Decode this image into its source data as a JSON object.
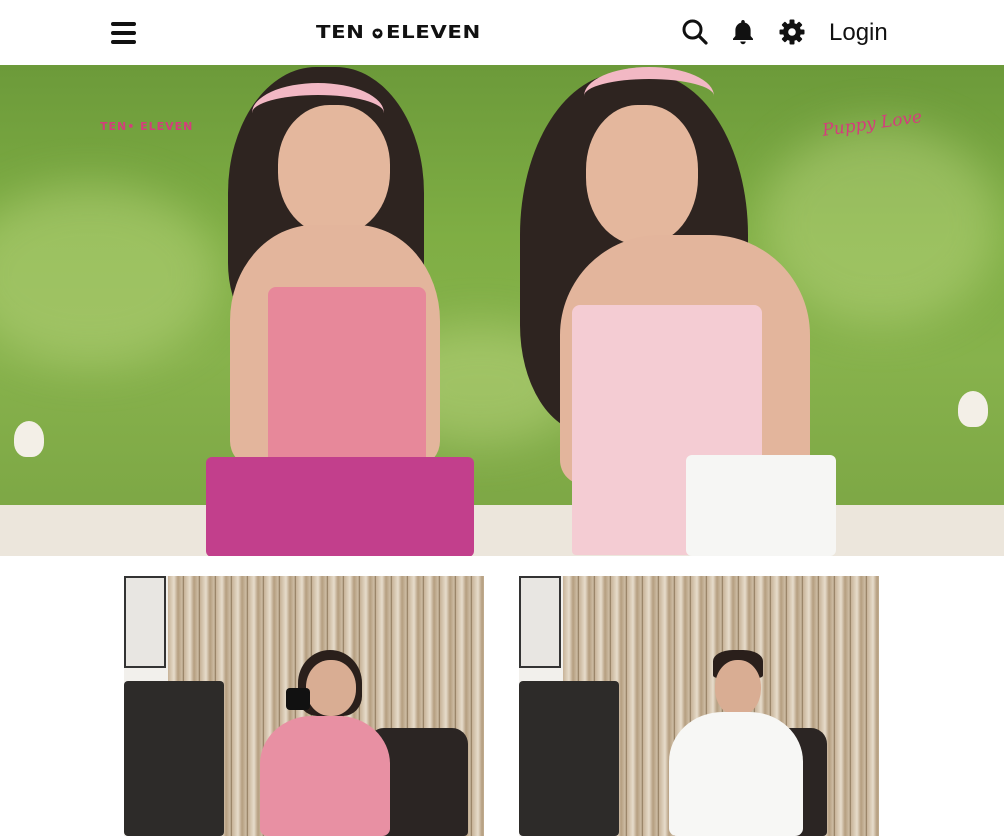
{
  "header": {
    "menu_icon": "hamburger-menu-icon",
    "logo": {
      "left_word": "TEN",
      "right_word": "ELEVEN",
      "separator_icon": "heart-dot-icon"
    },
    "icons": [
      "search-icon",
      "bell-icon",
      "gear-icon"
    ],
    "login_label": "Login"
  },
  "hero": {
    "type": "banner-image",
    "brand_tag": "TEN• ELEVEN",
    "script_tag": "Puppy Love",
    "accent_color": "#d43d7c"
  },
  "products": [
    {
      "type": "product-image",
      "subject": "pink-knit-dress"
    },
    {
      "type": "product-image",
      "subject": "white-polo-shirt"
    }
  ],
  "colors": {
    "header_bg": "#ffffff",
    "text": "#111111",
    "page_bg": "#ffffff"
  }
}
